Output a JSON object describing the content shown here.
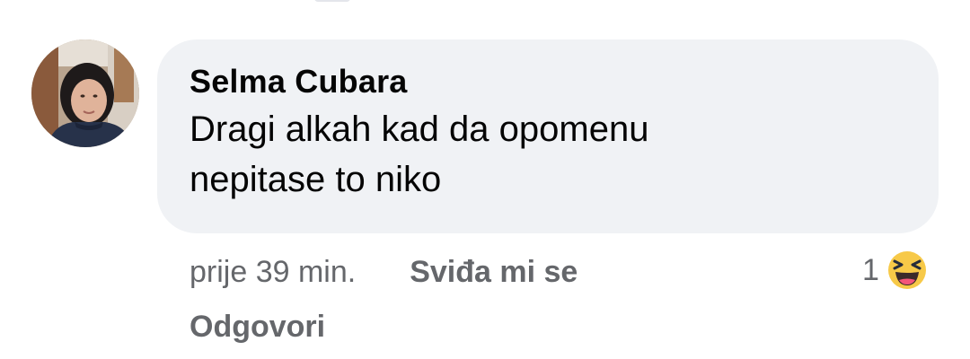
{
  "comment": {
    "author": "Selma Cubara",
    "text": "Dragi alkah kad da opomenu nepitase to niko",
    "timestamp": "prije 39 min.",
    "like_label": "Sviđa mi se",
    "reply_label": "Odgovori",
    "reaction_count": "1",
    "reaction_icon": "haha-emoji-icon"
  },
  "colors": {
    "bubble_bg": "#f0f2f5",
    "text": "#050505",
    "secondary_text": "#65676b",
    "haha_yellow": "#f7c948"
  }
}
